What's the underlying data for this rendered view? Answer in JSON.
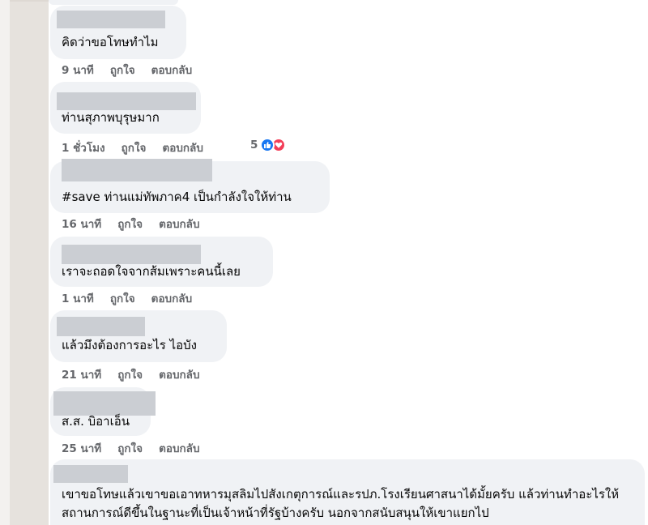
{
  "colors": {
    "bubble": "#f0f2f5",
    "meta_text": "#65676b",
    "comment_text": "#050505",
    "like_blue": "#1877f2",
    "love_red": "#f33e58",
    "redaction": "#cbced3"
  },
  "actions": {
    "like": "ถูกใจ",
    "reply": "ตอบกลับ"
  },
  "comments": [
    {
      "text": "คิดว่าขอโทษทำไม",
      "time": "9 นาที"
    },
    {
      "text": "ท่านสุภาพบุรุษมาก",
      "time": "1 ชั่วโมง",
      "reaction_count": "5",
      "reaction_icons": [
        "like-icon",
        "love-icon"
      ]
    },
    {
      "text": "#save ท่านแม่ทัพภาค4 เป็นกำลังใจให้ท่าน",
      "time": "16 นาที"
    },
    {
      "text": "เราจะถอดใจจากส้มเพราะคนนี้เลย",
      "time": "1 นาที"
    },
    {
      "text": "แล้วมึงต้องการอะไร ไอบัง",
      "time": "21 นาที"
    },
    {
      "text": "ส.ส. บิอาเอ็น",
      "time": "25 นาที"
    },
    {
      "text": "เขาขอโทษแล้วเขาขอเอาทหารมุสลิมไปสังเกตุการณ์และรปภ.โรงเรียนศาสนาได้มั้ยครับ แล้วท่านทำอะไรให้สถานการณ์ดีขึ้นในฐานะที่เป็นเจ้าหน้าที่รัฐบ้างครับ นอกจากสนับสนุนให้เขาแยกไป"
    }
  ]
}
